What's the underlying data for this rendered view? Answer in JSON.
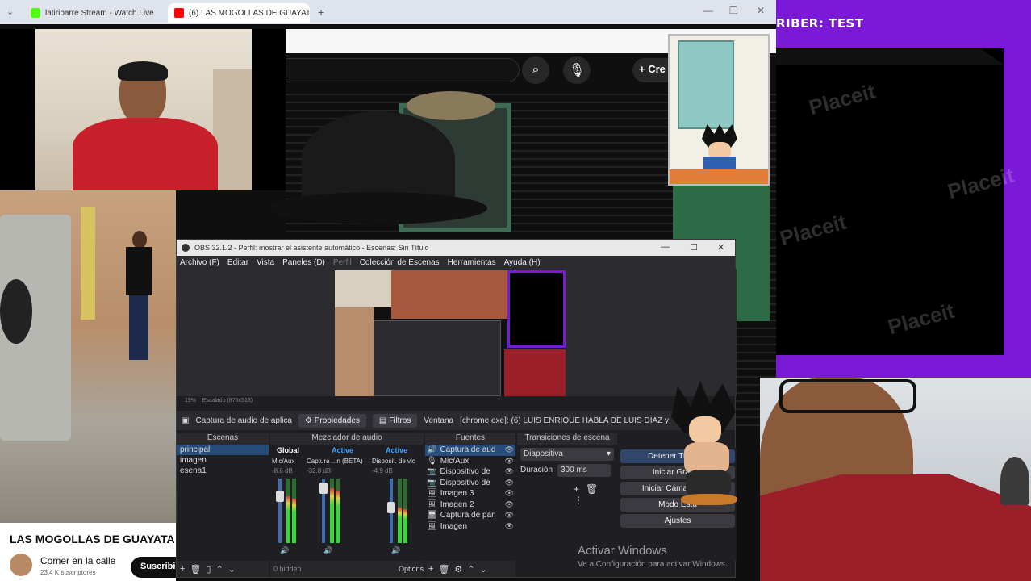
{
  "browser": {
    "tabs": [
      {
        "title": "latiribarre Stream - Watch Live",
        "favicon_color": "#53fc18"
      },
      {
        "title": "(6) LAS MOGOLLAS DE GUAYATA",
        "favicon_color": "#ff0000",
        "active": true
      }
    ],
    "new_tab": "+",
    "window_buttons": [
      "—",
      "❐",
      "✕"
    ]
  },
  "youtube": {
    "create_label": "Cre",
    "video_title": "LAS MOGOLLAS DE GUAYATA",
    "channel_name": "Comer en la calle",
    "subscribers": "23,4 K suscriptores",
    "subscribe_label": "Suscribir"
  },
  "overlay": {
    "title": "RIBER: TEST",
    "watermarks": [
      "Placeit",
      "Placeit",
      "Placeit",
      "Placeit"
    ]
  },
  "obs": {
    "title": "OBS 32.1.2 - Perfil: mostrar el asistente automático - Escenas: Sin Título",
    "menu": [
      "Archivo (F)",
      "Editar",
      "Vista",
      "Paneles (D)",
      "Perfil",
      "Colección de Escenas",
      "Herramientas",
      "Ayuda (H)"
    ],
    "zoom_bar": {
      "zoom": "19%",
      "scale": "Escalado (876x513)"
    },
    "source_bar": {
      "selected_source": "Captura de audio de aplica",
      "properties": "Propiedades",
      "filters": "Filtros",
      "window_label": "Ventana",
      "window_value": "[chrome.exe]: (6) LUIS ENRIQUE HABLA DE LUIS DIAZ y"
    },
    "docks": {
      "scenes": {
        "header": "Escenas",
        "items": [
          "principal",
          "imagen",
          "esena1"
        ]
      },
      "mixer": {
        "header": "Mezclador de audio",
        "tabs": [
          "Global",
          "Active",
          "Active"
        ],
        "channels": [
          {
            "name": "Mic/Aux",
            "db": "-8.6 dB",
            "level": 0.72
          },
          {
            "name": "Captura ...n (BETA)",
            "db": "-32.8 dB",
            "level": 0.85
          },
          {
            "name": "Disposit. de vic",
            "db": "-4.9 dB",
            "level": 0.55
          }
        ],
        "scale": [
          "0",
          "-6",
          "-12",
          "-18",
          "-24",
          "-30",
          "-36",
          "-42",
          "-48",
          "-54",
          "-60"
        ],
        "hidden": "0 hidden",
        "options": "Options"
      },
      "sources": {
        "header": "Fuentes",
        "items": [
          {
            "name": "Captura de aud",
            "icon": "🔊"
          },
          {
            "name": "Mic/Aux",
            "icon": "🎙"
          },
          {
            "name": "Dispositivo de",
            "icon": "📷"
          },
          {
            "name": "Dispositivo de",
            "icon": "📷"
          },
          {
            "name": "Imagen 3",
            "icon": "🖼"
          },
          {
            "name": "Imagen 2",
            "icon": "🖼"
          },
          {
            "name": "Captura de pan",
            "icon": "🖥"
          },
          {
            "name": "Imagen",
            "icon": "🖼"
          }
        ]
      },
      "transitions": {
        "header": "Transiciones de escena",
        "type": "Diapositiva",
        "duration_label": "Duración",
        "duration_value": "300 ms"
      },
      "controls": {
        "buttons": [
          "Detener Transmi",
          "Iniciar Grabac",
          "Iniciar Cámara Virtu",
          "Modo Estu",
          "Ajustes"
        ]
      }
    }
  },
  "windows_activation": {
    "line1": "Activar Windows",
    "line2": "Ve a Configuración para activar Windows."
  }
}
